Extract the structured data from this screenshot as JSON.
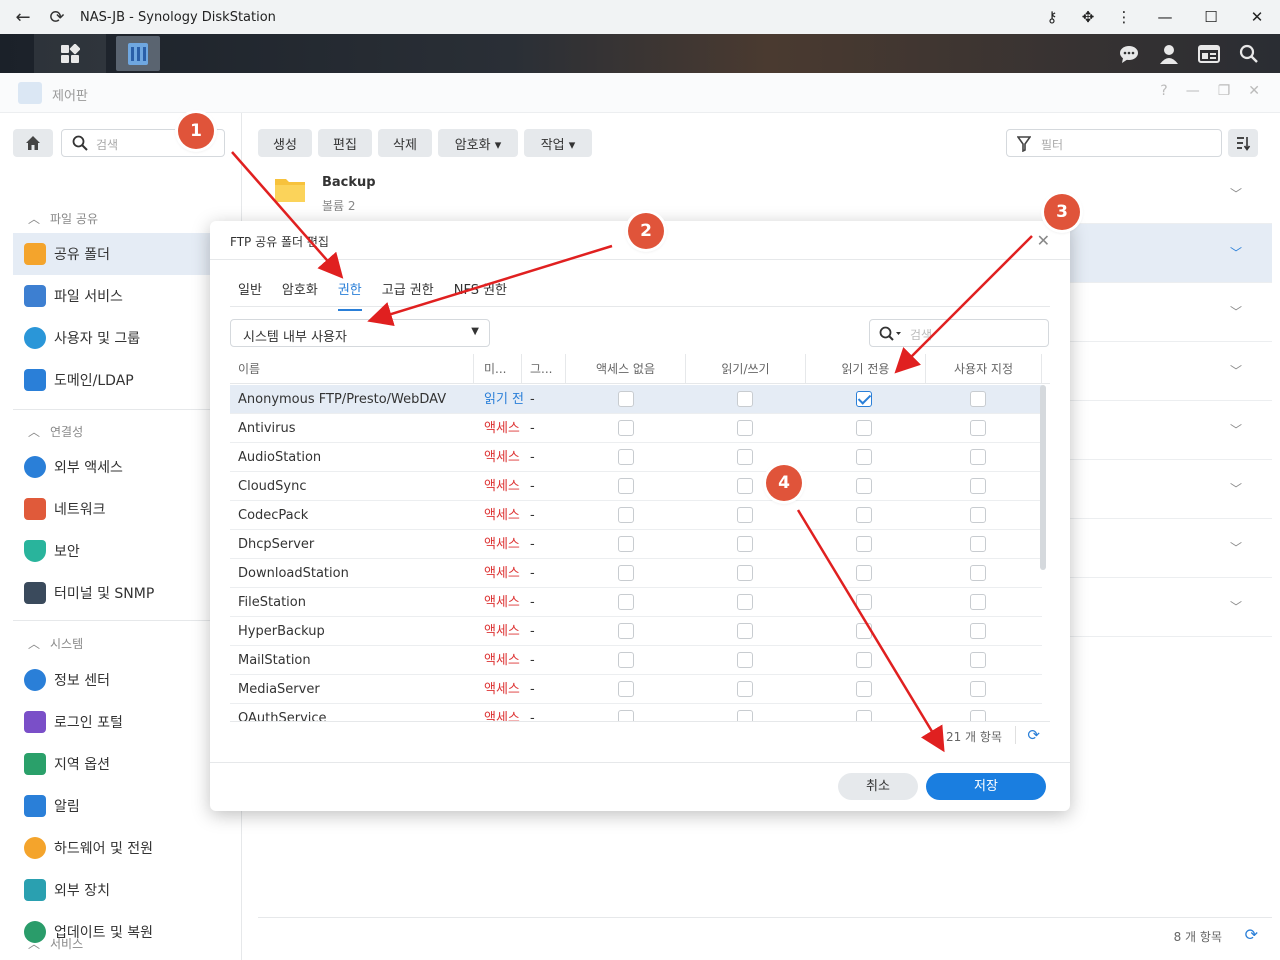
{
  "browser": {
    "title": "NAS-JB - Synology DiskStation"
  },
  "window": {
    "title": "제어판"
  },
  "sidebar": {
    "search_placeholder": "검색",
    "sections": [
      {
        "label": "파일 공유"
      },
      {
        "label": "연결성"
      },
      {
        "label": "시스템"
      },
      {
        "label": "서비스"
      }
    ],
    "items": [
      {
        "label": "공유 폴더",
        "color": "#f4a42c"
      },
      {
        "label": "파일 서비스",
        "color": "#3d7fd1"
      },
      {
        "label": "사용자 및 그룹",
        "color": "#2a96d8"
      },
      {
        "label": "도메인/LDAP",
        "color": "#2a7fd8"
      },
      {
        "label": "외부 액세스",
        "color": "#2a7fd8"
      },
      {
        "label": "네트워크",
        "color": "#e05a3a"
      },
      {
        "label": "보안",
        "color": "#29b49c"
      },
      {
        "label": "터미널 및 SNMP",
        "color": "#3a4a5c"
      },
      {
        "label": "정보 센터",
        "color": "#2a7fd8"
      },
      {
        "label": "로그인 포털",
        "color": "#7a4fc8"
      },
      {
        "label": "지역 옵션",
        "color": "#2aa06a"
      },
      {
        "label": "알림",
        "color": "#2a7fd8"
      },
      {
        "label": "하드웨어 및 전원",
        "color": "#f4a42c"
      },
      {
        "label": "외부 장치",
        "color": "#2aa0b0"
      },
      {
        "label": "업데이트 및 복원",
        "color": "#2a9c6a"
      }
    ]
  },
  "toolbar": {
    "create": "생성",
    "edit": "편집",
    "delete": "삭제",
    "encrypt": "암호화 ▾",
    "action": "작업 ▾",
    "filter_placeholder": "필터"
  },
  "folders": [
    {
      "name": "Backup",
      "sub": "볼륨 2"
    }
  ],
  "main_footer": {
    "count": "8 개 항목"
  },
  "modal": {
    "title": "FTP 공유 폴더 편집",
    "tabs": [
      "일반",
      "암호화",
      "권한",
      "고급 권한",
      "NFS 권한"
    ],
    "active_tab": "권한",
    "user_select": "시스템 내부 사용자",
    "search_placeholder": "검색",
    "columns": [
      "이름",
      "미...",
      "그...",
      "액세스 없음",
      "읽기/쓰기",
      "읽기 전용",
      "사용자 지정"
    ],
    "rows": [
      {
        "name": "Anonymous FTP/Presto/WebDAV",
        "perm": "읽기 전",
        "group": "-",
        "no_access": false,
        "rw": false,
        "ro": true,
        "custom": false
      },
      {
        "name": "Antivirus",
        "perm": "액세스",
        "group": "-",
        "no_access": false,
        "rw": false,
        "ro": false,
        "custom": false
      },
      {
        "name": "AudioStation",
        "perm": "액세스",
        "group": "-",
        "no_access": false,
        "rw": false,
        "ro": false,
        "custom": false
      },
      {
        "name": "CloudSync",
        "perm": "액세스",
        "group": "-",
        "no_access": false,
        "rw": false,
        "ro": false,
        "custom": false
      },
      {
        "name": "CodecPack",
        "perm": "액세스",
        "group": "-",
        "no_access": false,
        "rw": false,
        "ro": false,
        "custom": false
      },
      {
        "name": "DhcpServer",
        "perm": "액세스",
        "group": "-",
        "no_access": false,
        "rw": false,
        "ro": false,
        "custom": false
      },
      {
        "name": "DownloadStation",
        "perm": "액세스",
        "group": "-",
        "no_access": false,
        "rw": false,
        "ro": false,
        "custom": false
      },
      {
        "name": "FileStation",
        "perm": "액세스",
        "group": "-",
        "no_access": false,
        "rw": false,
        "ro": false,
        "custom": false
      },
      {
        "name": "HyperBackup",
        "perm": "액세스",
        "group": "-",
        "no_access": false,
        "rw": false,
        "ro": false,
        "custom": false
      },
      {
        "name": "MailStation",
        "perm": "액세스",
        "group": "-",
        "no_access": false,
        "rw": false,
        "ro": false,
        "custom": false
      },
      {
        "name": "MediaServer",
        "perm": "액세스",
        "group": "-",
        "no_access": false,
        "rw": false,
        "ro": false,
        "custom": false
      },
      {
        "name": "OAuthService",
        "perm": "액세스",
        "group": "-",
        "no_access": false,
        "rw": false,
        "ro": false,
        "custom": false
      }
    ],
    "count": "21 개 항목",
    "cancel": "취소",
    "save": "저장"
  },
  "annotations": {
    "badges": [
      "1",
      "2",
      "3",
      "4"
    ],
    "color": "#e0543a",
    "arrow_color": "#e02020"
  },
  "colors": {
    "accent": "#2a7fd8",
    "save_button": "#1a7ee0",
    "denied_text": "#d33"
  }
}
